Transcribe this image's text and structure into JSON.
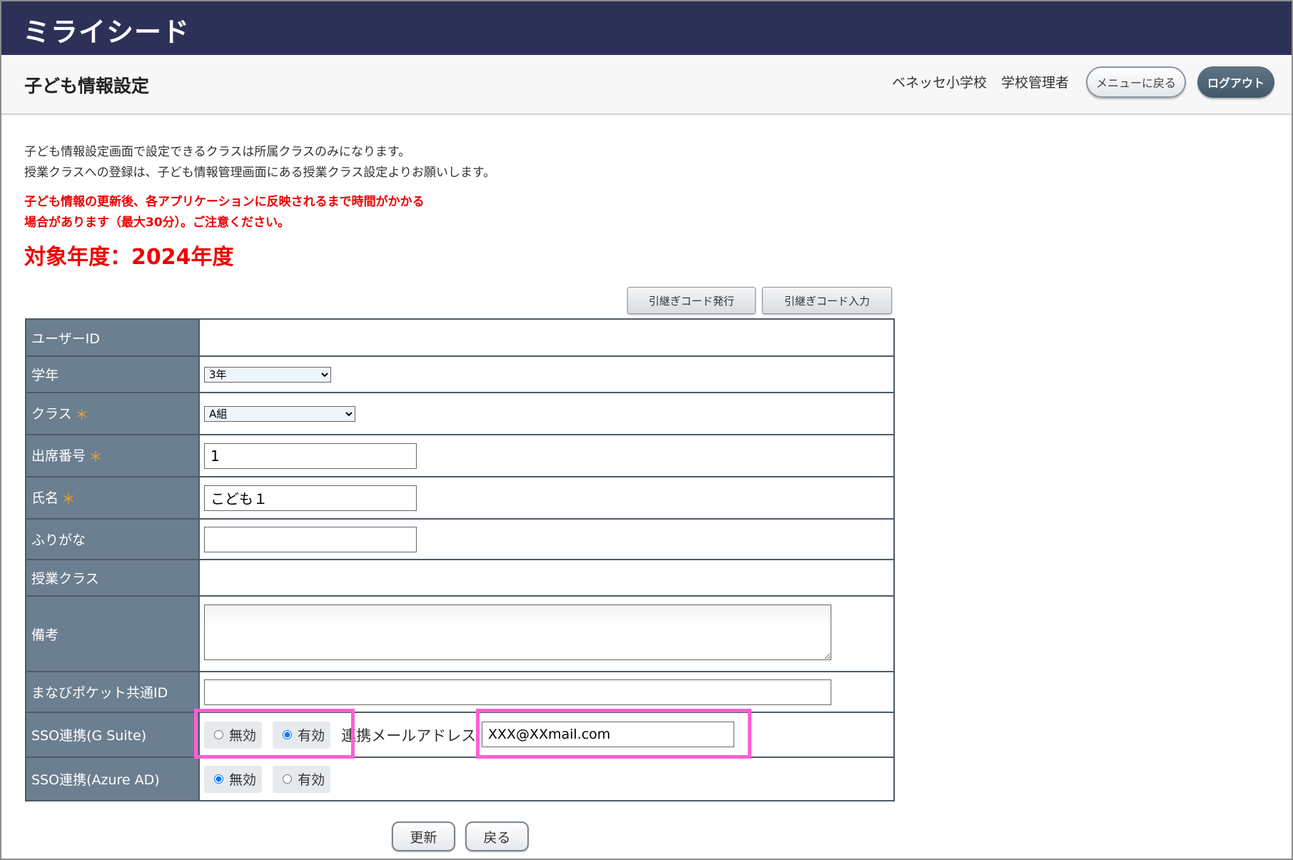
{
  "app": {
    "logo": "ミライシード"
  },
  "header": {
    "title": "子ども情報設定",
    "school": "ベネッセ小学校",
    "role": "学校管理者",
    "menu_button": "メニューに戻る",
    "logout_button": "ログアウト"
  },
  "notes": {
    "line1": "子ども情報設定画面で設定できるクラスは所属クラスのみになります。",
    "line2": "授業クラスへの登録は、子ども情報管理画面にある授業クラス設定よりお願いします。",
    "warn1": "子ども情報の更新後、各アプリケーションに反映されるまで時間がかかる",
    "warn2": "場合があります（最大30分）。ご注意ください。",
    "target_year": "対象年度：2024年度"
  },
  "code_buttons": {
    "issue": "引継ぎコード発行",
    "input": "引継ぎコード入力"
  },
  "form": {
    "labels": {
      "user_id": "ユーザーID",
      "grade": "学年",
      "class": "クラス",
      "attendance": "出席番号",
      "name": "氏名",
      "furigana": "ふりがな",
      "lesson_class": "授業クラス",
      "memo": "備考",
      "manabi_id": "まなびポケット共通ID",
      "sso_gsuite": "SSO連携(G Suite)",
      "sso_azure": "SSO連携(Azure AD)"
    },
    "required_mark": "＊",
    "grade_value": "3年",
    "class_value": "A組",
    "attendance_value": "1",
    "name_value": "こども１",
    "furigana_value": "",
    "manabi_value": "",
    "radio_disabled": "無効",
    "radio_enabled": "有効",
    "gsuite_selected": "有効",
    "azure_selected": "無効",
    "email_label": "連携メールアドレス",
    "email_value": "XXX@XXmail.com"
  },
  "actions": {
    "update": "更新",
    "back": "戻る"
  },
  "colors": {
    "topbar": "#2e3157",
    "label_bg": "#6c7f90",
    "warning": "#ee0000",
    "highlight": "#ff5fd1",
    "required": "#f2a11f"
  }
}
